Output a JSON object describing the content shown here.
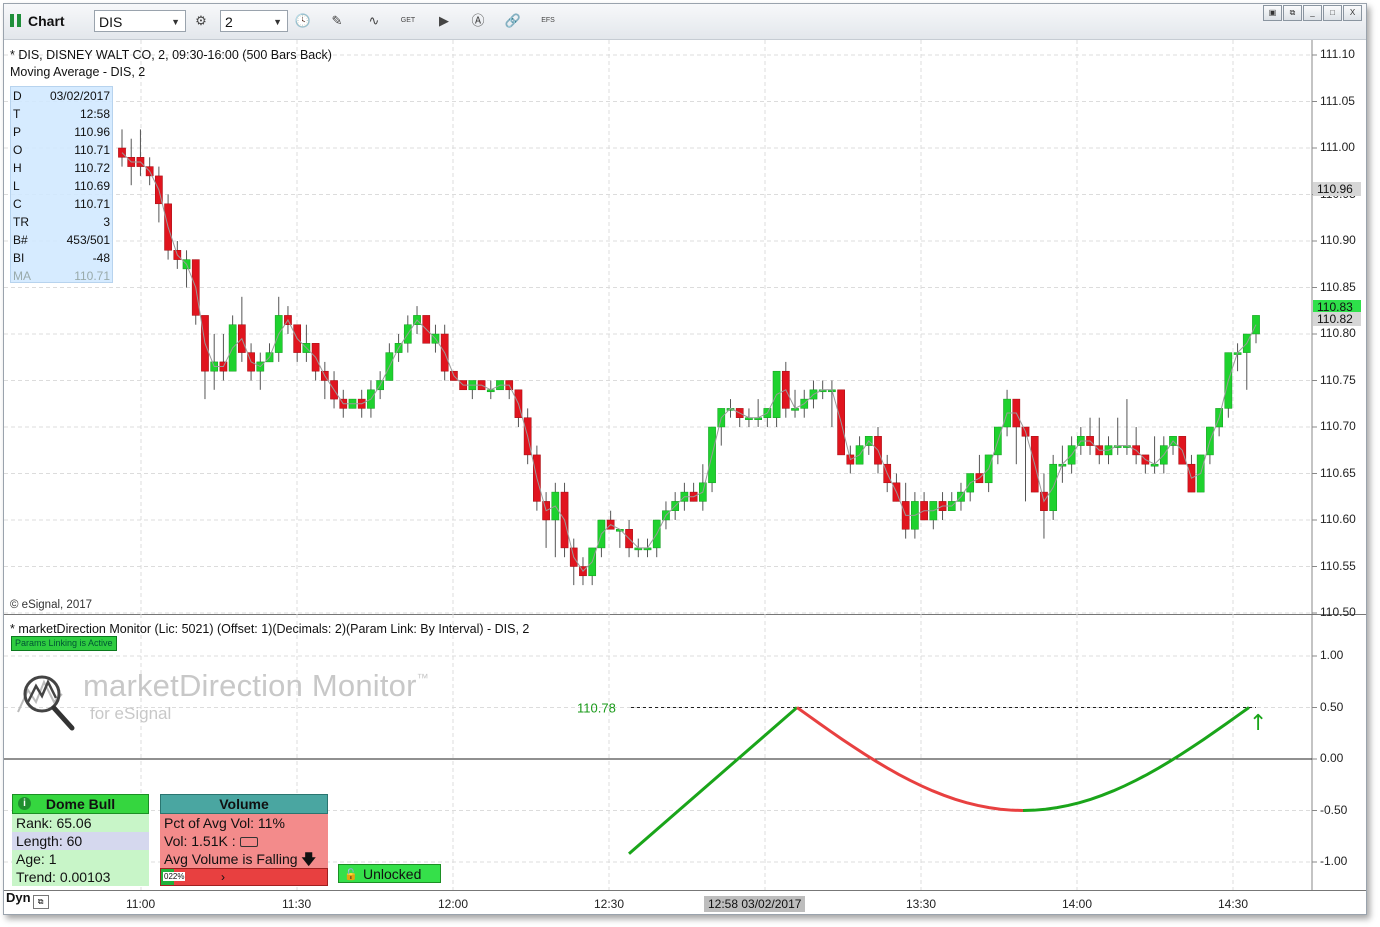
{
  "toolbar": {
    "title": "Chart",
    "symbol": "DIS",
    "interval": "2",
    "icons": [
      "settings-icon",
      "clock-icon",
      "draw-icon",
      "study-icon",
      "get-icon",
      "play-icon",
      "alert-icon",
      "link-icon",
      "efs-icon"
    ],
    "efs_label": "EFS",
    "get_label": "GET",
    "window_buttons": [
      "▣",
      "⧉",
      "_",
      "□",
      "X"
    ]
  },
  "price_pane": {
    "header": "* DIS, DISNEY WALT CO, 2, 09:30-16:00 (500 Bars Back)",
    "study": "Moving Average - DIS, 2",
    "copyright": "© eSignal, 2017",
    "y_ticks": [
      "111.10",
      "111.05",
      "111.00",
      "110.95",
      "110.90",
      "110.85",
      "110.80",
      "110.75",
      "110.70",
      "110.65",
      "110.60",
      "110.55",
      "110.50"
    ],
    "tags": [
      {
        "label": "110.96",
        "color": "#d6d6d6",
        "text": "#111"
      },
      {
        "label": "110.83",
        "color": "#2ee04a",
        "text": "#111"
      },
      {
        "label": "110.82",
        "color": "#d6d6d6",
        "text": "#111"
      }
    ]
  },
  "cursor_info": [
    {
      "k": "D",
      "v": "03/02/2017"
    },
    {
      "k": "T",
      "v": "12:58"
    },
    {
      "k": "P",
      "v": "110.96"
    },
    {
      "k": "O",
      "v": "110.71"
    },
    {
      "k": "H",
      "v": "110.72"
    },
    {
      "k": "L",
      "v": "110.69"
    },
    {
      "k": "C",
      "v": "110.71"
    },
    {
      "k": "TR",
      "v": "3"
    },
    {
      "k": "B#",
      "v": "453/501"
    },
    {
      "k": "BI",
      "v": "-48"
    },
    {
      "k": "MA",
      "v": "110.71"
    }
  ],
  "indicator_pane": {
    "header": "* marketDirection Monitor (Lic: 5021) (Offset: 1)(Decimals: 2)(Param Link: By Interval) - DIS, 2",
    "params_badge": "Params Linking is Active",
    "logo_title": "marketDirection Monitor",
    "logo_tm": "™",
    "logo_sub": "for eSignal",
    "peak_label": "110.78",
    "y_ticks": [
      "1.00",
      "0.50",
      "0.00",
      "-0.50",
      "-1.00"
    ],
    "arrow": "↑"
  },
  "dome_panel": {
    "title": "Dome Bull",
    "rows": [
      "Rank: 65.06",
      "Length: 60",
      "Age: 1",
      "Trend: 0.00103"
    ],
    "row_colors": [
      "#c8f5c8",
      "#d5d8ee",
      "#c8f5c8",
      "#c8f5c8"
    ]
  },
  "volume_panel": {
    "title": "Volume",
    "rows": [
      "Pct of Avg Vol: 11%",
      "Vol: 1.51K : ",
      "Avg Volume is Falling"
    ],
    "progress_pct": "022%",
    "progress_fraction": 0.22,
    "falling_arrow": "🡇"
  },
  "unlocked_button": {
    "label": "Unlocked"
  },
  "x_axis": {
    "ticks": [
      "11:00",
      "11:30",
      "12:00",
      "12:30",
      "13:00",
      "13:30",
      "14:00",
      "14:30"
    ],
    "cursor_label": "12:58 03/02/2017",
    "dyn_label": "Dyn"
  },
  "chart_data": {
    "type": "candlestick",
    "y_range": [
      110.5,
      111.1
    ],
    "bars_ohlc": [
      [
        111.0,
        111.02,
        110.98,
        110.99
      ],
      [
        110.99,
        111.01,
        110.96,
        110.98
      ],
      [
        110.99,
        111.02,
        110.97,
        110.98
      ],
      [
        110.98,
        110.99,
        110.96,
        110.97
      ],
      [
        110.97,
        110.98,
        110.92,
        110.94
      ],
      [
        110.94,
        110.95,
        110.88,
        110.89
      ],
      [
        110.89,
        110.9,
        110.87,
        110.88
      ],
      [
        110.87,
        110.89,
        110.85,
        110.88
      ],
      [
        110.88,
        110.88,
        110.81,
        110.82
      ],
      [
        110.82,
        110.82,
        110.73,
        110.76
      ],
      [
        110.76,
        110.8,
        110.74,
        110.77
      ],
      [
        110.77,
        110.8,
        110.75,
        110.76
      ],
      [
        110.76,
        110.82,
        110.76,
        110.81
      ],
      [
        110.81,
        110.84,
        110.77,
        110.78
      ],
      [
        110.78,
        110.79,
        110.75,
        110.76
      ],
      [
        110.76,
        110.78,
        110.74,
        110.77
      ],
      [
        110.77,
        110.79,
        110.77,
        110.78
      ],
      [
        110.78,
        110.84,
        110.77,
        110.82
      ],
      [
        110.82,
        110.83,
        110.8,
        110.81
      ],
      [
        110.81,
        110.81,
        110.77,
        110.78
      ],
      [
        110.78,
        110.81,
        110.77,
        110.79
      ],
      [
        110.79,
        110.79,
        110.75,
        110.76
      ],
      [
        110.76,
        110.77,
        110.73,
        110.75
      ],
      [
        110.75,
        110.76,
        110.72,
        110.73
      ],
      [
        110.73,
        110.74,
        110.71,
        110.72
      ],
      [
        110.72,
        110.73,
        110.72,
        110.73
      ],
      [
        110.73,
        110.74,
        110.71,
        110.72
      ],
      [
        110.72,
        110.75,
        110.71,
        110.74
      ],
      [
        110.74,
        110.76,
        110.73,
        110.75
      ],
      [
        110.75,
        110.79,
        110.75,
        110.78
      ],
      [
        110.78,
        110.8,
        110.77,
        110.79
      ],
      [
        110.79,
        110.82,
        110.78,
        110.81
      ],
      [
        110.81,
        110.83,
        110.8,
        110.82
      ],
      [
        110.82,
        110.82,
        110.79,
        110.79
      ],
      [
        110.79,
        110.81,
        110.78,
        110.8
      ],
      [
        110.8,
        110.81,
        110.75,
        110.76
      ],
      [
        110.76,
        110.76,
        110.75,
        110.75
      ],
      [
        110.75,
        110.75,
        110.74,
        110.74
      ],
      [
        110.74,
        110.75,
        110.73,
        110.75
      ],
      [
        110.75,
        110.75,
        110.74,
        110.74
      ],
      [
        110.74,
        110.75,
        110.73,
        110.74
      ],
      [
        110.74,
        110.75,
        110.74,
        110.75
      ],
      [
        110.75,
        110.75,
        110.73,
        110.74
      ],
      [
        110.74,
        110.74,
        110.7,
        110.71
      ],
      [
        110.71,
        110.72,
        110.66,
        110.67
      ],
      [
        110.67,
        110.68,
        110.61,
        110.62
      ],
      [
        110.62,
        110.63,
        110.57,
        110.6
      ],
      [
        110.6,
        110.64,
        110.56,
        110.63
      ],
      [
        110.63,
        110.64,
        110.56,
        110.57
      ],
      [
        110.57,
        110.58,
        110.53,
        110.55
      ],
      [
        110.55,
        110.56,
        110.53,
        110.54
      ],
      [
        110.54,
        110.57,
        110.53,
        110.57
      ],
      [
        110.57,
        110.6,
        110.56,
        110.6
      ],
      [
        110.6,
        110.61,
        110.59,
        110.59
      ],
      [
        110.59,
        110.59,
        110.57,
        110.59
      ],
      [
        110.59,
        110.6,
        110.56,
        110.57
      ],
      [
        110.57,
        110.58,
        110.56,
        110.57
      ],
      [
        110.57,
        110.58,
        110.56,
        110.57
      ],
      [
        110.57,
        110.6,
        110.56,
        110.6
      ],
      [
        110.6,
        110.62,
        110.59,
        110.61
      ],
      [
        110.61,
        110.63,
        110.6,
        110.62
      ],
      [
        110.62,
        110.64,
        110.61,
        110.63
      ],
      [
        110.63,
        110.64,
        110.62,
        110.62
      ],
      [
        110.62,
        110.66,
        110.61,
        110.64
      ],
      [
        110.64,
        110.7,
        110.63,
        110.7
      ],
      [
        110.7,
        110.72,
        110.68,
        110.72
      ],
      [
        110.72,
        110.73,
        110.71,
        110.72
      ],
      [
        110.72,
        110.72,
        110.7,
        110.71
      ],
      [
        110.71,
        110.72,
        110.7,
        110.71
      ],
      [
        110.71,
        110.73,
        110.7,
        110.71
      ],
      [
        110.71,
        110.72,
        110.7,
        110.72
      ],
      [
        110.71,
        110.76,
        110.7,
        110.76
      ],
      [
        110.76,
        110.77,
        110.71,
        110.72
      ],
      [
        110.72,
        110.74,
        110.71,
        110.72
      ],
      [
        110.72,
        110.74,
        110.71,
        110.73
      ],
      [
        110.73,
        110.75,
        110.72,
        110.74
      ],
      [
        110.74,
        110.75,
        110.73,
        110.74
      ],
      [
        110.74,
        110.75,
        110.7,
        110.74
      ],
      [
        110.74,
        110.74,
        110.67,
        110.67
      ],
      [
        110.67,
        110.68,
        110.65,
        110.66
      ],
      [
        110.66,
        110.69,
        110.66,
        110.68
      ],
      [
        110.68,
        110.69,
        110.67,
        110.69
      ],
      [
        110.69,
        110.7,
        110.65,
        110.66
      ],
      [
        110.66,
        110.67,
        110.63,
        110.64
      ],
      [
        110.64,
        110.65,
        110.62,
        110.62
      ],
      [
        110.62,
        110.64,
        110.58,
        110.59
      ],
      [
        110.59,
        110.63,
        110.58,
        110.62
      ],
      [
        110.62,
        110.63,
        110.6,
        110.6
      ],
      [
        110.6,
        110.62,
        110.59,
        110.62
      ],
      [
        110.62,
        110.63,
        110.6,
        110.61
      ],
      [
        110.61,
        110.63,
        110.61,
        110.62
      ],
      [
        110.62,
        110.64,
        110.61,
        110.63
      ],
      [
        110.63,
        110.65,
        110.62,
        110.65
      ],
      [
        110.65,
        110.67,
        110.64,
        110.64
      ],
      [
        110.64,
        110.67,
        110.63,
        110.67
      ],
      [
        110.67,
        110.7,
        110.66,
        110.7
      ],
      [
        110.7,
        110.74,
        110.69,
        110.73
      ],
      [
        110.73,
        110.73,
        110.66,
        110.7
      ],
      [
        110.7,
        110.7,
        110.62,
        110.69
      ],
      [
        110.69,
        110.69,
        110.63,
        110.63
      ],
      [
        110.63,
        110.65,
        110.58,
        110.61
      ],
      [
        110.61,
        110.67,
        110.6,
        110.66
      ],
      [
        110.66,
        110.68,
        110.64,
        110.66
      ],
      [
        110.66,
        110.69,
        110.65,
        110.68
      ],
      [
        110.68,
        110.7,
        110.67,
        110.69
      ],
      [
        110.69,
        110.71,
        110.67,
        110.68
      ],
      [
        110.68,
        110.71,
        110.66,
        110.67
      ],
      [
        110.67,
        110.69,
        110.66,
        110.68
      ],
      [
        110.68,
        110.71,
        110.67,
        110.68
      ],
      [
        110.68,
        110.73,
        110.67,
        110.68
      ],
      [
        110.68,
        110.7,
        110.66,
        110.67
      ],
      [
        110.67,
        110.67,
        110.65,
        110.66
      ],
      [
        110.66,
        110.69,
        110.65,
        110.66
      ],
      [
        110.66,
        110.69,
        110.65,
        110.68
      ],
      [
        110.68,
        110.69,
        110.67,
        110.69
      ],
      [
        110.69,
        110.69,
        110.66,
        110.66
      ],
      [
        110.66,
        110.67,
        110.63,
        110.63
      ],
      [
        110.63,
        110.67,
        110.63,
        110.67
      ],
      [
        110.67,
        110.7,
        110.66,
        110.7
      ],
      [
        110.7,
        110.72,
        110.69,
        110.72
      ],
      [
        110.72,
        110.78,
        110.71,
        110.78
      ],
      [
        110.78,
        110.79,
        110.76,
        110.78
      ],
      [
        110.78,
        110.8,
        110.74,
        110.8
      ],
      [
        110.8,
        110.82,
        110.79,
        110.82
      ]
    ],
    "oscillator": {
      "segments": [
        {
          "color": "#1aa51a",
          "points": [
            [
              0,
              -0.92
            ],
            [
              1,
              0.5
            ]
          ]
        },
        {
          "color": "#e84040",
          "points": [
            [
              1,
              0.5
            ],
            [
              2,
              -0.5
            ]
          ]
        },
        {
          "color": "#1aa51a",
          "points": [
            [
              2,
              -0.5
            ],
            [
              3,
              0.5
            ]
          ]
        }
      ],
      "y_range": [
        -1.25,
        1.25
      ]
    }
  }
}
